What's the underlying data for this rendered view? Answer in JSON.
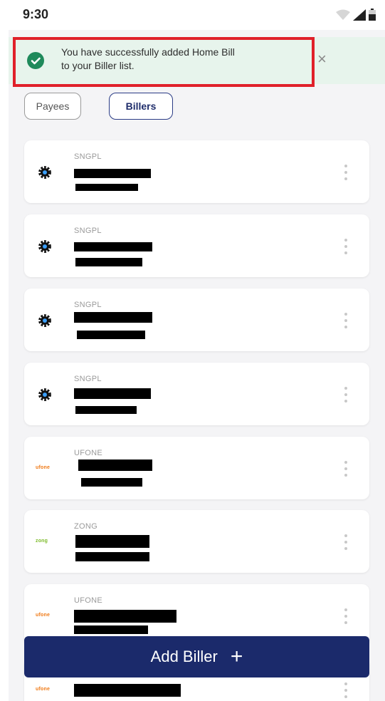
{
  "status_bar": {
    "time": "9:30"
  },
  "toast": {
    "message": "You have successfully added Home Bill\nto your Biller list.",
    "close_glyph": "×",
    "accent_color": "#1f8a5b"
  },
  "tabs": [
    {
      "label": "Payees",
      "selected": false
    },
    {
      "label": "Billers",
      "selected": true
    }
  ],
  "billers": [
    {
      "provider": "SNGPL",
      "logo": "gas-icon"
    },
    {
      "provider": "SNGPL",
      "logo": "gas-icon"
    },
    {
      "provider": "SNGPL",
      "logo": "gas-icon"
    },
    {
      "provider": "SNGPL",
      "logo": "gas-icon"
    },
    {
      "provider": "UFONE",
      "logo": "ufone-logo"
    },
    {
      "provider": "ZONG",
      "logo": "zong-logo"
    },
    {
      "provider": "UFONE",
      "logo": "ufone-logo"
    },
    {
      "provider": "",
      "logo": "ufone-logo"
    }
  ],
  "logos": {
    "ufone_text": "ufone",
    "zong_text": "zong"
  },
  "add_button": {
    "label": "Add Biller",
    "icon": "+"
  },
  "colors": {
    "primary": "#1b2a6b",
    "highlight": "#e0202a"
  }
}
